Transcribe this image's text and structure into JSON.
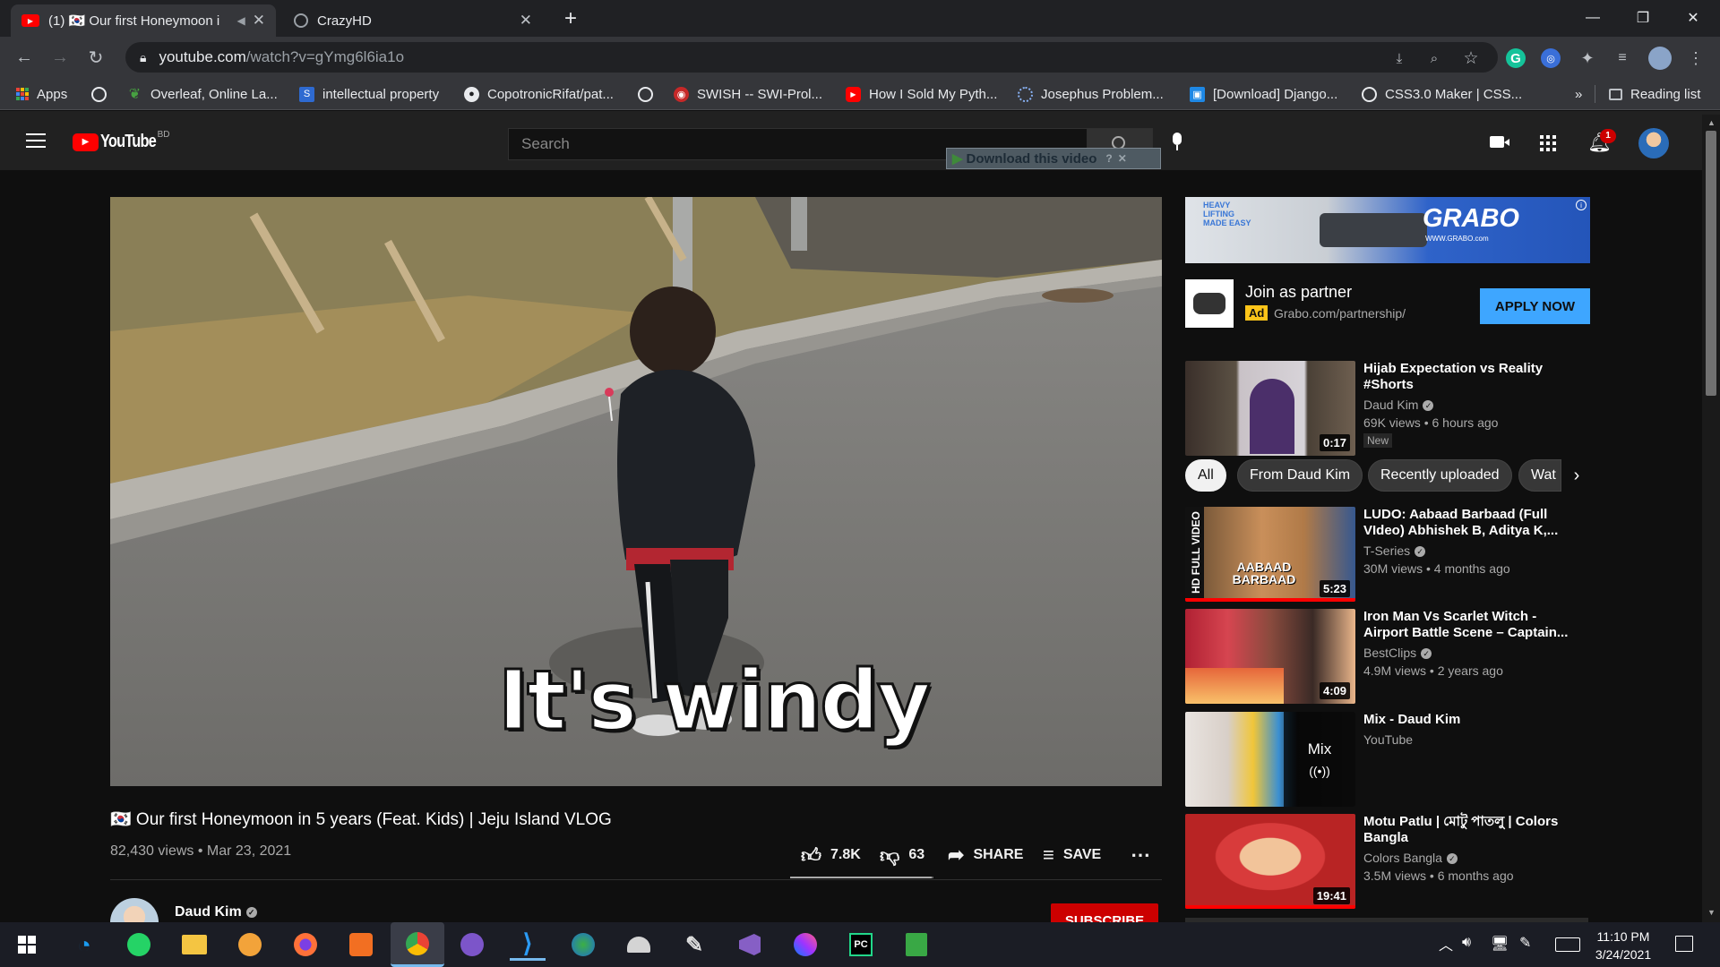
{
  "browser": {
    "tabs": [
      {
        "title": "(1) 🇰🇷 Our first Honeymoon i",
        "active": true
      },
      {
        "title": "CrazyHD",
        "active": false
      }
    ],
    "url_host": "youtube.com",
    "url_path": "/watch?v=gYmg6l6ia1o",
    "bookmarks": [
      "Apps",
      "Overleaf, Online La...",
      "intellectual property",
      "CopotronicRifat/pat...",
      "SWISH -- SWI-Prol...",
      "How I Sold My Pyth...",
      "Josephus Problem...",
      "[Download] Django...",
      "CSS3.0 Maker | CSS..."
    ],
    "bookmarks_overflow": "»",
    "reading_list": "Reading list"
  },
  "yt": {
    "logo": "YouTube",
    "region": "BD",
    "search_placeholder": "Search",
    "download_label": "Download this video",
    "notif_count": "1"
  },
  "video": {
    "caption": "It's windy",
    "title": "🇰🇷 Our first Honeymoon in 5 years (Feat. Kids) | Jeju Island VLOG",
    "views": "82,430 views",
    "date": "Mar 23, 2021",
    "likes": "7.8K",
    "dislikes": "63",
    "share": "SHARE",
    "save": "SAVE",
    "channel": "Daud Kim",
    "subscribe": "SUBSCRIBE"
  },
  "ad": {
    "banner_brand": "GRABO",
    "banner_slogan": "HEAVY LIFTING MADE EASY",
    "banner_url": "WWW.GRABO.com",
    "title": "Join as partner",
    "badge": "Ad",
    "url": "Grabo.com/partnership/",
    "cta": "APPLY NOW"
  },
  "chips": [
    "All",
    "From Daud Kim",
    "Recently uploaded",
    "Wat"
  ],
  "recommended": [
    {
      "title": "Hijab Expectation vs Reality #Shorts",
      "channel": "Daud Kim",
      "stats": "69K views • 6 hours ago",
      "duration": "0:17",
      "badge": "New"
    },
    {
      "title": "LUDO: Aabaad Barbaad (Full VIdeo) Abhishek B, Aditya K,...",
      "channel": "T-Series",
      "stats": "30M views • 4 months ago",
      "duration": "5:23",
      "thumb_text": "AABAAD BARBAAD",
      "side_text": "HD FULL VIDEO"
    },
    {
      "title": "Iron Man Vs Scarlet Witch - Airport Battle Scene – Captain...",
      "channel": "BestClips",
      "stats": "4.9M views • 2 years ago",
      "duration": "4:09"
    },
    {
      "title": "Mix - Daud Kim",
      "channel": "YouTube",
      "stats": "",
      "duration": "",
      "mix_label": "Mix"
    },
    {
      "title": "Motu Patlu | মোটু পাতলু | Colors Bangla",
      "channel": "Colors Bangla",
      "stats": "3.5M views • 6 months ago",
      "duration": "19:41"
    }
  ],
  "clock": {
    "time": "11:10 PM",
    "date": "3/24/2021"
  }
}
